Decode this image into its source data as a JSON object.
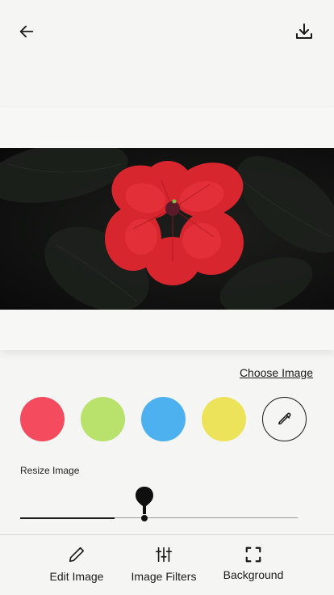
{
  "header": {
    "back_icon": "arrow-left-icon",
    "download_icon": "download-icon"
  },
  "editor": {
    "photo_description_icon": "red-flower-photo",
    "choose_image_label": "Choose Image"
  },
  "colors": {
    "swatches": [
      "#f44b5f",
      "#b8e26c",
      "#4db0ef",
      "#ede35a"
    ],
    "picker_icon": "eyedropper-icon"
  },
  "resize": {
    "label": "Resize Image",
    "value_fraction": 0.34
  },
  "bottom_nav": {
    "items": [
      {
        "label": "Edit Image",
        "icon": "pencil-icon"
      },
      {
        "label": "Image Filters",
        "icon": "sliders-icon"
      },
      {
        "label": "Background",
        "icon": "expand-corners-icon"
      }
    ]
  }
}
